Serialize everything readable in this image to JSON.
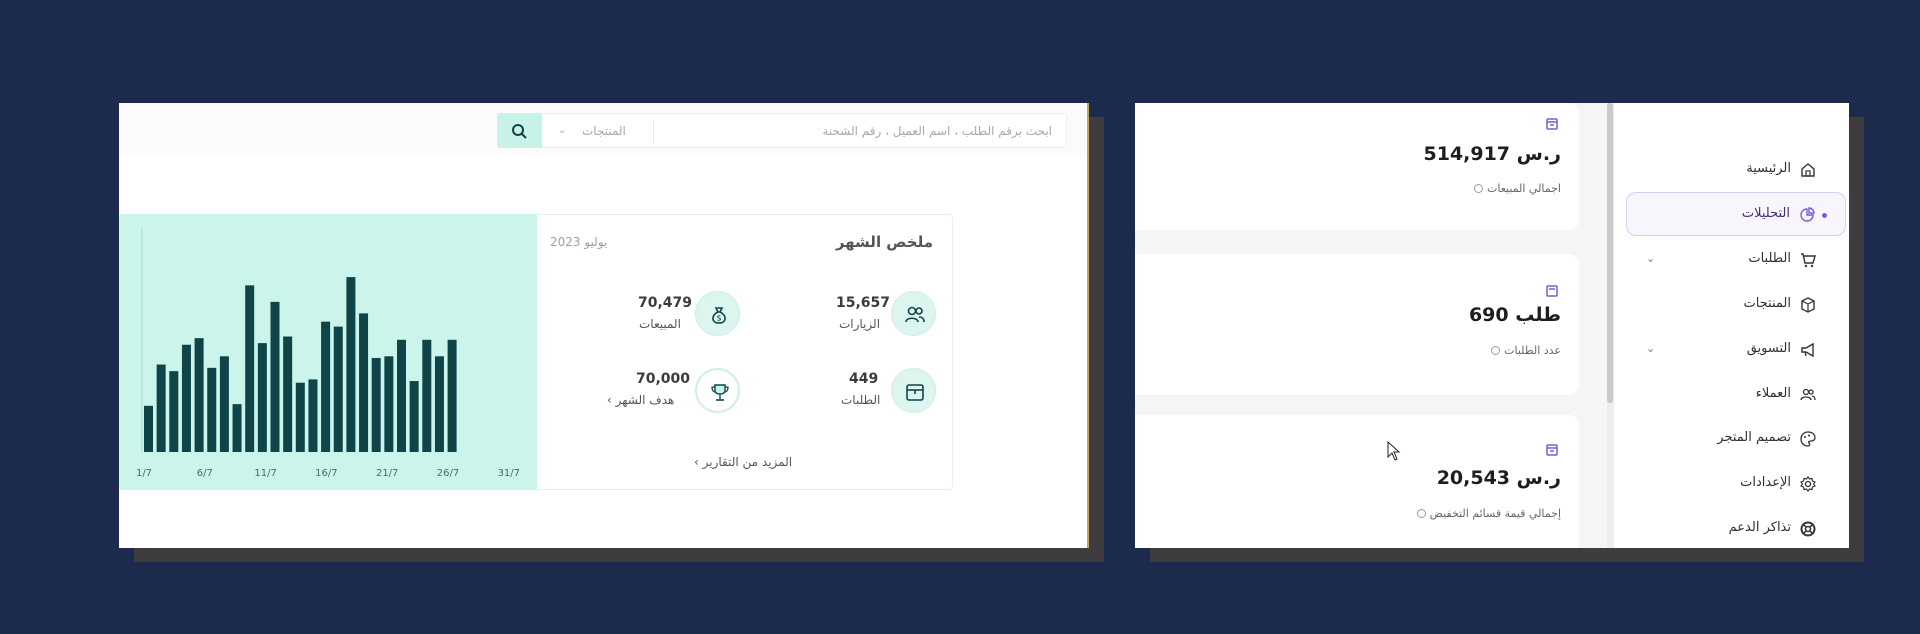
{
  "colors": {
    "background": "#1c2a4e",
    "accent_teal": "#0f4549",
    "chart_bg": "#cbf4ea",
    "active_purple": "#7b5cd6"
  },
  "search": {
    "placeholder": "ابحث برقم الطلب ، اسم العميل ، رقم الشحنة",
    "category": "المنتجات",
    "button_icon": "search-icon"
  },
  "summary": {
    "title": "ملخص الشهر",
    "date": "يوليو 2023",
    "visits_value": "15,657",
    "visits_label": "الزيارات",
    "sales_value": "70,479",
    "sales_label": "المبيعات",
    "orders_value": "449",
    "orders_label": "الطلبات",
    "goal_value": "70,000",
    "goal_label": "هدف الشهر",
    "more_reports": "المزيد من التقارير"
  },
  "chart_data": {
    "type": "bar",
    "x_ticks": [
      "1/7",
      "6/7",
      "11/7",
      "16/7",
      "21/7",
      "26/7",
      "31/7"
    ],
    "values": [
      2.8,
      5.3,
      4.9,
      6.5,
      6.9,
      5.1,
      5.8,
      2.9,
      10.1,
      6.6,
      9.1,
      7.0,
      4.2,
      4.4,
      7.9,
      7.6,
      10.6,
      8.4,
      5.7,
      5.8,
      6.8,
      4.3,
      6.8,
      5.8,
      6.8
    ]
  },
  "cards": [
    {
      "icon": "receipt-icon",
      "value": "514,917 ر.س",
      "label": "اجمالي المبيعات"
    },
    {
      "icon": "document-icon",
      "value": "690 طلب",
      "label": "عدد الطلبات"
    },
    {
      "icon": "receipt-icon",
      "value": "20,543 ر.س",
      "label": "إجمالي قيمة قسائم التخفيض"
    }
  ],
  "sidebar": {
    "items": [
      {
        "label": "الرئيسية",
        "icon": "home-icon"
      },
      {
        "label": "التحليلات",
        "icon": "pie-chart-icon",
        "active": true
      },
      {
        "label": "الطلبات",
        "icon": "cart-icon",
        "chevron": true
      },
      {
        "label": "المنتجات",
        "icon": "box-icon"
      },
      {
        "label": "التسويق",
        "icon": "megaphone-icon",
        "chevron": true
      },
      {
        "label": "العملاء",
        "icon": "users-icon"
      },
      {
        "label": "تصميم المتجر",
        "icon": "palette-icon"
      },
      {
        "label": "الإعدادات",
        "icon": "gear-icon"
      },
      {
        "label": "تذاكر الدعم",
        "icon": "lifebuoy-icon"
      }
    ]
  }
}
